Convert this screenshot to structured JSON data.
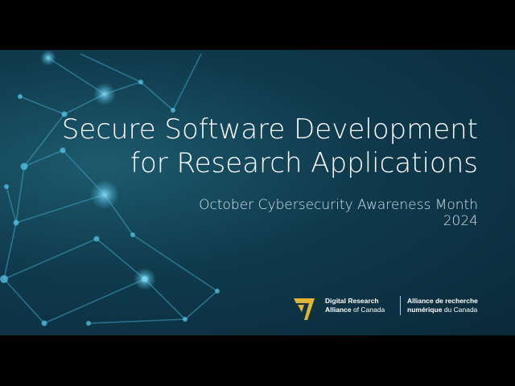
{
  "slide": {
    "title_line1": "Secure Software Development",
    "title_line2": "for Research Applications",
    "subtitle_line1": "October Cybersecurity Awareness Month",
    "subtitle_line2": "2024"
  },
  "logo": {
    "en_line1": "Digital Research",
    "en_line2_bold": "Alliance",
    "en_line2_rest": " of Canada",
    "fr_line1": "Alliance de recherche",
    "fr_line2_bold": "numérique",
    "fr_line2_rest": " du Canada",
    "mark_color": "#e2b534"
  },
  "colors": {
    "background": "#0f3a4c",
    "network_line": "#3fa3c4",
    "node": "#57c3e3"
  }
}
